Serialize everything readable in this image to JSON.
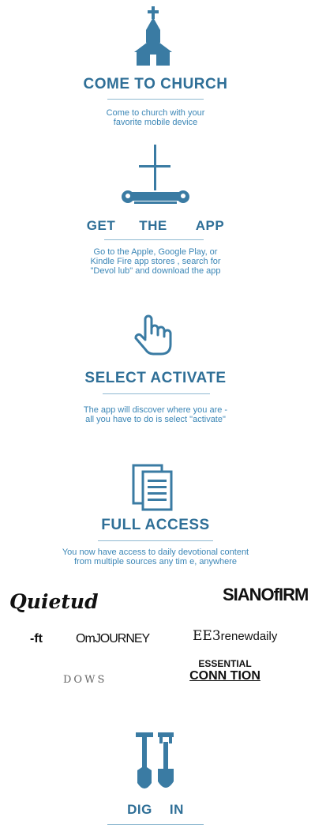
{
  "steps": [
    {
      "title": "COME TO CHURCH",
      "desc_lines": [
        "Come to church with your",
        "favorite mobile device"
      ],
      "icon": "church-icon"
    },
    {
      "title": "GET THE APP",
      "desc_lines": [
        "Go to the Apple, Google Play, or",
        "Kindle Fire app stores , search for",
        "\"Devol lub\" and download the app"
      ],
      "icon": "cross-scroll-icon"
    },
    {
      "title": "SELECT ACTIVATE",
      "desc_lines": [
        "The app will discover where you are -",
        "all you have to do is select \"activate\""
      ],
      "icon": "pointer-hand-icon"
    },
    {
      "title": "FULL ACCESS",
      "desc_lines": [
        "You now have access to daily devotional content",
        "from multiple sources any tim e, anywhere"
      ],
      "icon": "documents-icon"
    },
    {
      "title": "DIG IN",
      "icon": "shovel-icon"
    }
  ],
  "get_app_words": [
    "GET",
    "THE",
    "APP"
  ],
  "dig_in_words": [
    "DIG",
    "IN"
  ],
  "partners": {
    "quietud": "Quietud",
    "sianofirm": "SIANOfIRM",
    "ft": "-ft",
    "omjourney": "OmJOURNEY",
    "renewdaily_mark": "EE3",
    "renewdaily": "renewdaily",
    "dows": "DOWS",
    "essential": "ESSENTIAL",
    "conntion": "CONN TION"
  },
  "colors": {
    "title": "#2f6f97",
    "desc": "#3b86b6",
    "icon": "#3a7ba3",
    "rule": "#8fb9d1"
  }
}
